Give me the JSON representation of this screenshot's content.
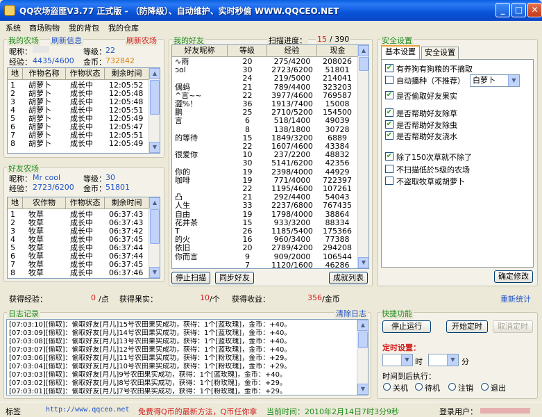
{
  "window": {
    "title": "QQ农场盗匪V3.77 正式版 - （防降级）、自动维护、实时秒偷 WWW.QQCEO.NET"
  },
  "menu": [
    "系统",
    "商场购物",
    "我的背包",
    "我的仓库"
  ],
  "my_farm": {
    "label": "我的农场",
    "refresh_info": "刷新信息",
    "refresh_farm": "刷新农场",
    "nickname_label": "昵称：",
    "nickname": "",
    "level_label": "等级：",
    "level": "22",
    "exp_label": "经验：",
    "exp": "4435/4600",
    "gold_label": "金币：",
    "gold": "732842",
    "columns": [
      "地",
      "作物名称",
      "作物状态",
      "剩余时间"
    ],
    "rows": [
      [
        "1",
        "胡萝卜",
        "成长中",
        "12:05:52"
      ],
      [
        "2",
        "胡萝卜",
        "成长中",
        "12:05:48"
      ],
      [
        "3",
        "胡萝卜",
        "成长中",
        "12:05:48"
      ],
      [
        "4",
        "胡萝卜",
        "成长中",
        "12:05:51"
      ],
      [
        "5",
        "胡萝卜",
        "成长中",
        "12:05:49"
      ],
      [
        "6",
        "胡萝卜",
        "成长中",
        "12:05:47"
      ],
      [
        "7",
        "胡萝卜",
        "成长中",
        "12:05:51"
      ],
      [
        "8",
        "胡萝卜",
        "成长中",
        "12:05:49"
      ]
    ]
  },
  "friend_farm": {
    "label": "好友农场",
    "nickname_label": "昵称：",
    "nickname": "Mr cool",
    "level_label": "等级：",
    "level": "30",
    "exp_label": "经验：",
    "exp": "2723/6200",
    "gold_label": "金币：",
    "gold": "51801",
    "columns": [
      "地",
      "农作物",
      "作物状态",
      "剩余时间"
    ],
    "rows": [
      [
        "1",
        "牧草",
        "成长中",
        "06:37:43"
      ],
      [
        "2",
        "牧草",
        "成长中",
        "06:37:43"
      ],
      [
        "3",
        "牧草",
        "成长中",
        "06:37:42"
      ],
      [
        "4",
        "牧草",
        "成长中",
        "06:37:45"
      ],
      [
        "5",
        "牧草",
        "成长中",
        "06:37:44"
      ],
      [
        "6",
        "牧草",
        "成长中",
        "06:37:44"
      ],
      [
        "7",
        "牧草",
        "成长中",
        "06:37:45"
      ],
      [
        "8",
        "牧草",
        "成长中",
        "06:37:46"
      ]
    ]
  },
  "my_friends": {
    "label": "我的好友",
    "scan_label": "扫描进度：",
    "scan_current": "15",
    "scan_total": "/ 390",
    "columns": [
      "好友昵称",
      "等级",
      "经验",
      "现金"
    ],
    "rows": [
      [
        "∿雨",
        "20",
        "275/4200",
        "208026"
      ],
      [
        "ɔol",
        "30",
        "2723/6200",
        "51801"
      ],
      [
        "",
        "24",
        "219/5000",
        "214041"
      ],
      [
        "偶蚂",
        "21",
        "789/4400",
        "323203"
      ],
      [
        "^言~~",
        "22",
        "3977/4600",
        "769587"
      ],
      [
        "澀%！",
        "36",
        "1913/7400",
        "15008"
      ],
      [
        "鹏",
        "25",
        "2710/5200",
        "154500"
      ],
      [
        "言",
        "6",
        "518/1400",
        "49039"
      ],
      [
        "",
        "8",
        "138/1800",
        "30728"
      ],
      [
        "的等待",
        "15",
        "1849/3200",
        "6889"
      ],
      [
        "",
        "22",
        "1607/4600",
        "43384"
      ],
      [
        "很爱你",
        "10",
        "237/2200",
        "48832"
      ],
      [
        "",
        "30",
        "5141/6200",
        "42356"
      ],
      [
        "你的",
        "19",
        "2398/4000",
        "44929"
      ],
      [
        "咖啡",
        "19",
        "771/4000",
        "722397"
      ],
      [
        "",
        "22",
        "1195/4600",
        "107261"
      ],
      [
        "凸",
        "21",
        "292/4400",
        "54043"
      ],
      [
        "人生",
        "33",
        "2237/6800",
        "767435"
      ],
      [
        "自由",
        "19",
        "1798/4000",
        "38864"
      ],
      [
        "花井茶",
        "15",
        "933/3200",
        "88334"
      ],
      [
        "T",
        "26",
        "1185/5400",
        "175366"
      ],
      [
        "的火",
        "16",
        "960/3400",
        "77388"
      ],
      [
        "依旧",
        "20",
        "2789/4200",
        "294208"
      ],
      [
        "你而言",
        "9",
        "909/2000",
        "106544"
      ],
      [
        "",
        "7",
        "1120/1600",
        "46286"
      ]
    ],
    "stop_scan": "停止扫描",
    "sync_friends": "同步好友",
    "achievements": "成就列表"
  },
  "security": {
    "label": "安全设置",
    "tabs": [
      "基本设置",
      "安全设置"
    ],
    "options": [
      {
        "label": "有养狗有狗粮的不摘取",
        "checked": true
      },
      {
        "label": "自动播种（不推荐）",
        "checked": false
      },
      {
        "label": "是否偷取好友果实",
        "checked": true
      },
      {
        "label": "是否帮助好友除草",
        "checked": true
      },
      {
        "label": "是否帮助好友除虫",
        "checked": true
      },
      {
        "label": "是否帮助好友浇水",
        "checked": true
      },
      {
        "label": "除了150次草就不除了",
        "checked": true
      },
      {
        "label": "不扫描低於5级的农场",
        "checked": false
      },
      {
        "label": "不盗取牧草或胡萝卜",
        "checked": false
      }
    ],
    "seed_select": "白萝卜",
    "confirm": "确定修改"
  },
  "stats": {
    "exp_label": "获得经验：",
    "exp_value": "0",
    "exp_unit": "/点",
    "fruit_label": "获得果实：",
    "fruit_value": "10",
    "fruit_unit": "/个",
    "income_label": "获得收益：",
    "income_value": "356",
    "income_unit": "/金币",
    "reset": "重新统计"
  },
  "log": {
    "label": "日志记录",
    "clear": "清除日志",
    "lines": [
      "[07:03:10][偷取]：偷取好友[月儿]15号农田果实成功，获得：1个[蓝玫瑰]，金币：+40。",
      "[07:03:09][偷取]：偷取好友[月儿]14号农田果实成功，获得：1个[蓝玫瑰]，金币：+40。",
      "[07:03:08][偷取]：偷取好友[月儿]13号农田果实成功，获得：1个[蓝玫瑰]，金币：+40。",
      "[07:03:07][偷取]：偷取好友[月儿]12号农田果实成功，获得：1个[蓝玫瑰]，金币：+40。",
      "[07:03:06][偷取]：偷取好友[月儿]11号农田果实成功，获得：1个[粉玫瑰]，金币：+29。",
      "[07:03:04][偷取]：偷取好友[月儿]10号农田果实成功，获得：1个[粉玫瑰]，金币：+29。",
      "[07:03:03][偷取]：偷取好友[月儿]9号农田果实成功，获得：1个[蓝玫瑰]，金币：+40。",
      "[07:03:02][偷取]：偷取好友[月儿]8号农田果实成功，获得：1个[粉玫瑰]，金币：+29。",
      "[07:03:01][偷取]：偷取好友[月儿]7号农田果实成功，获得：1个[粉玫瑰]，金币：+29。"
    ]
  },
  "quick": {
    "label": "快捷功能",
    "stop_run": "停止运行",
    "start_timer": "开始定时",
    "cancel_timer": "取消定时",
    "timer_label": "定时设置：",
    "hour_label": "时",
    "minute_label": "分",
    "after_label": "时间到后执行：",
    "radios": [
      "关机",
      "待机",
      "注销",
      "退出"
    ]
  },
  "status": {
    "tag": "标签",
    "url": "http://www.qqceo.net",
    "promo": "免费得Q币的最新方法，Q币任你拿",
    "time": "当前时间：2010年2月14日7时3分9秒",
    "login": "登录用户："
  },
  "colors": {
    "titlebar": "#0A5FE0",
    "accent_green": "#1E8C1E",
    "accent_blue": "#1F52C7",
    "accent_red": "#D02020"
  }
}
